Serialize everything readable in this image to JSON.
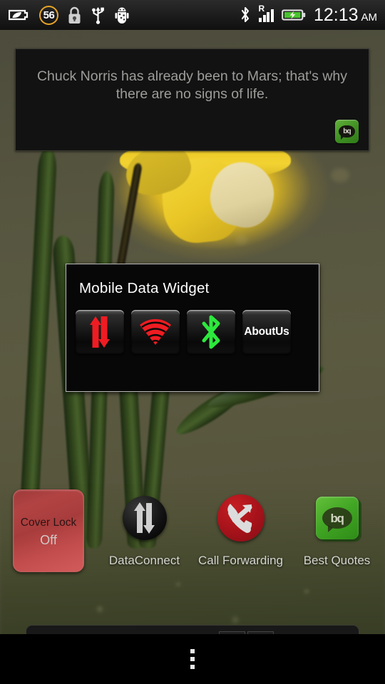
{
  "statusbar": {
    "left_icons": [
      {
        "name": "eco-battery-icon",
        "label": "eco-battery"
      },
      {
        "name": "lock-icon",
        "label": "screen-lock"
      },
      {
        "name": "usb-icon",
        "label": "usb-connected"
      },
      {
        "name": "android-debug-icon",
        "label": "usb-debugging"
      }
    ],
    "eco_count": "56",
    "roaming_indicator": "R",
    "signal_bars": 4,
    "signal_bars_total": 4,
    "bluetooth_icon": "bluetooth-icon",
    "battery_icon": "battery-charging-icon",
    "time": "12:13",
    "ampm": "AM"
  },
  "quote_widget": {
    "text": "Chuck Norris has already been to Mars; that's why there are no signs of life.",
    "badge_text": "bq",
    "badge_icon": "best-quotes-badge-icon"
  },
  "mobile_data_widget": {
    "title": "Mobile Data Widget",
    "buttons": [
      {
        "name": "mobile-data-toggle-button",
        "icon": "data-arrows-icon",
        "label": "",
        "state_color": "#ee1c22"
      },
      {
        "name": "wifi-toggle-button",
        "icon": "wifi-icon",
        "label": "",
        "state_color": "#ee1c22"
      },
      {
        "name": "bluetooth-toggle-button",
        "icon": "bluetooth-icon",
        "label": "",
        "state_color": "#2de83c"
      },
      {
        "name": "about-us-button",
        "icon": "",
        "label": "AboutUs",
        "state_color": "#ffffff"
      }
    ]
  },
  "cover_lock_widget": {
    "title": "Cover Lock",
    "state": "Off"
  },
  "home_icons": [
    {
      "name": "app-icon-dataconnect",
      "label": "DataConnect",
      "icon": "data-arrows-circle-icon"
    },
    {
      "name": "app-icon-call-forwarding",
      "label": "Call Forwarding",
      "icon": "call-forwarding-icon"
    },
    {
      "name": "app-icon-best-quotes",
      "label": "Best Quotes",
      "icon": "best-quotes-icon",
      "badge_text": "bq"
    }
  ],
  "navbar": {
    "overflow_button": "menu-overflow-button"
  },
  "colors": {
    "accent_red": "#ee1c22",
    "accent_green": "#2de83c",
    "brand_green": "#41a524",
    "eco_ring": "#e8a427",
    "widget_bg": "#070707",
    "cover_lock_red": "#b24343"
  }
}
